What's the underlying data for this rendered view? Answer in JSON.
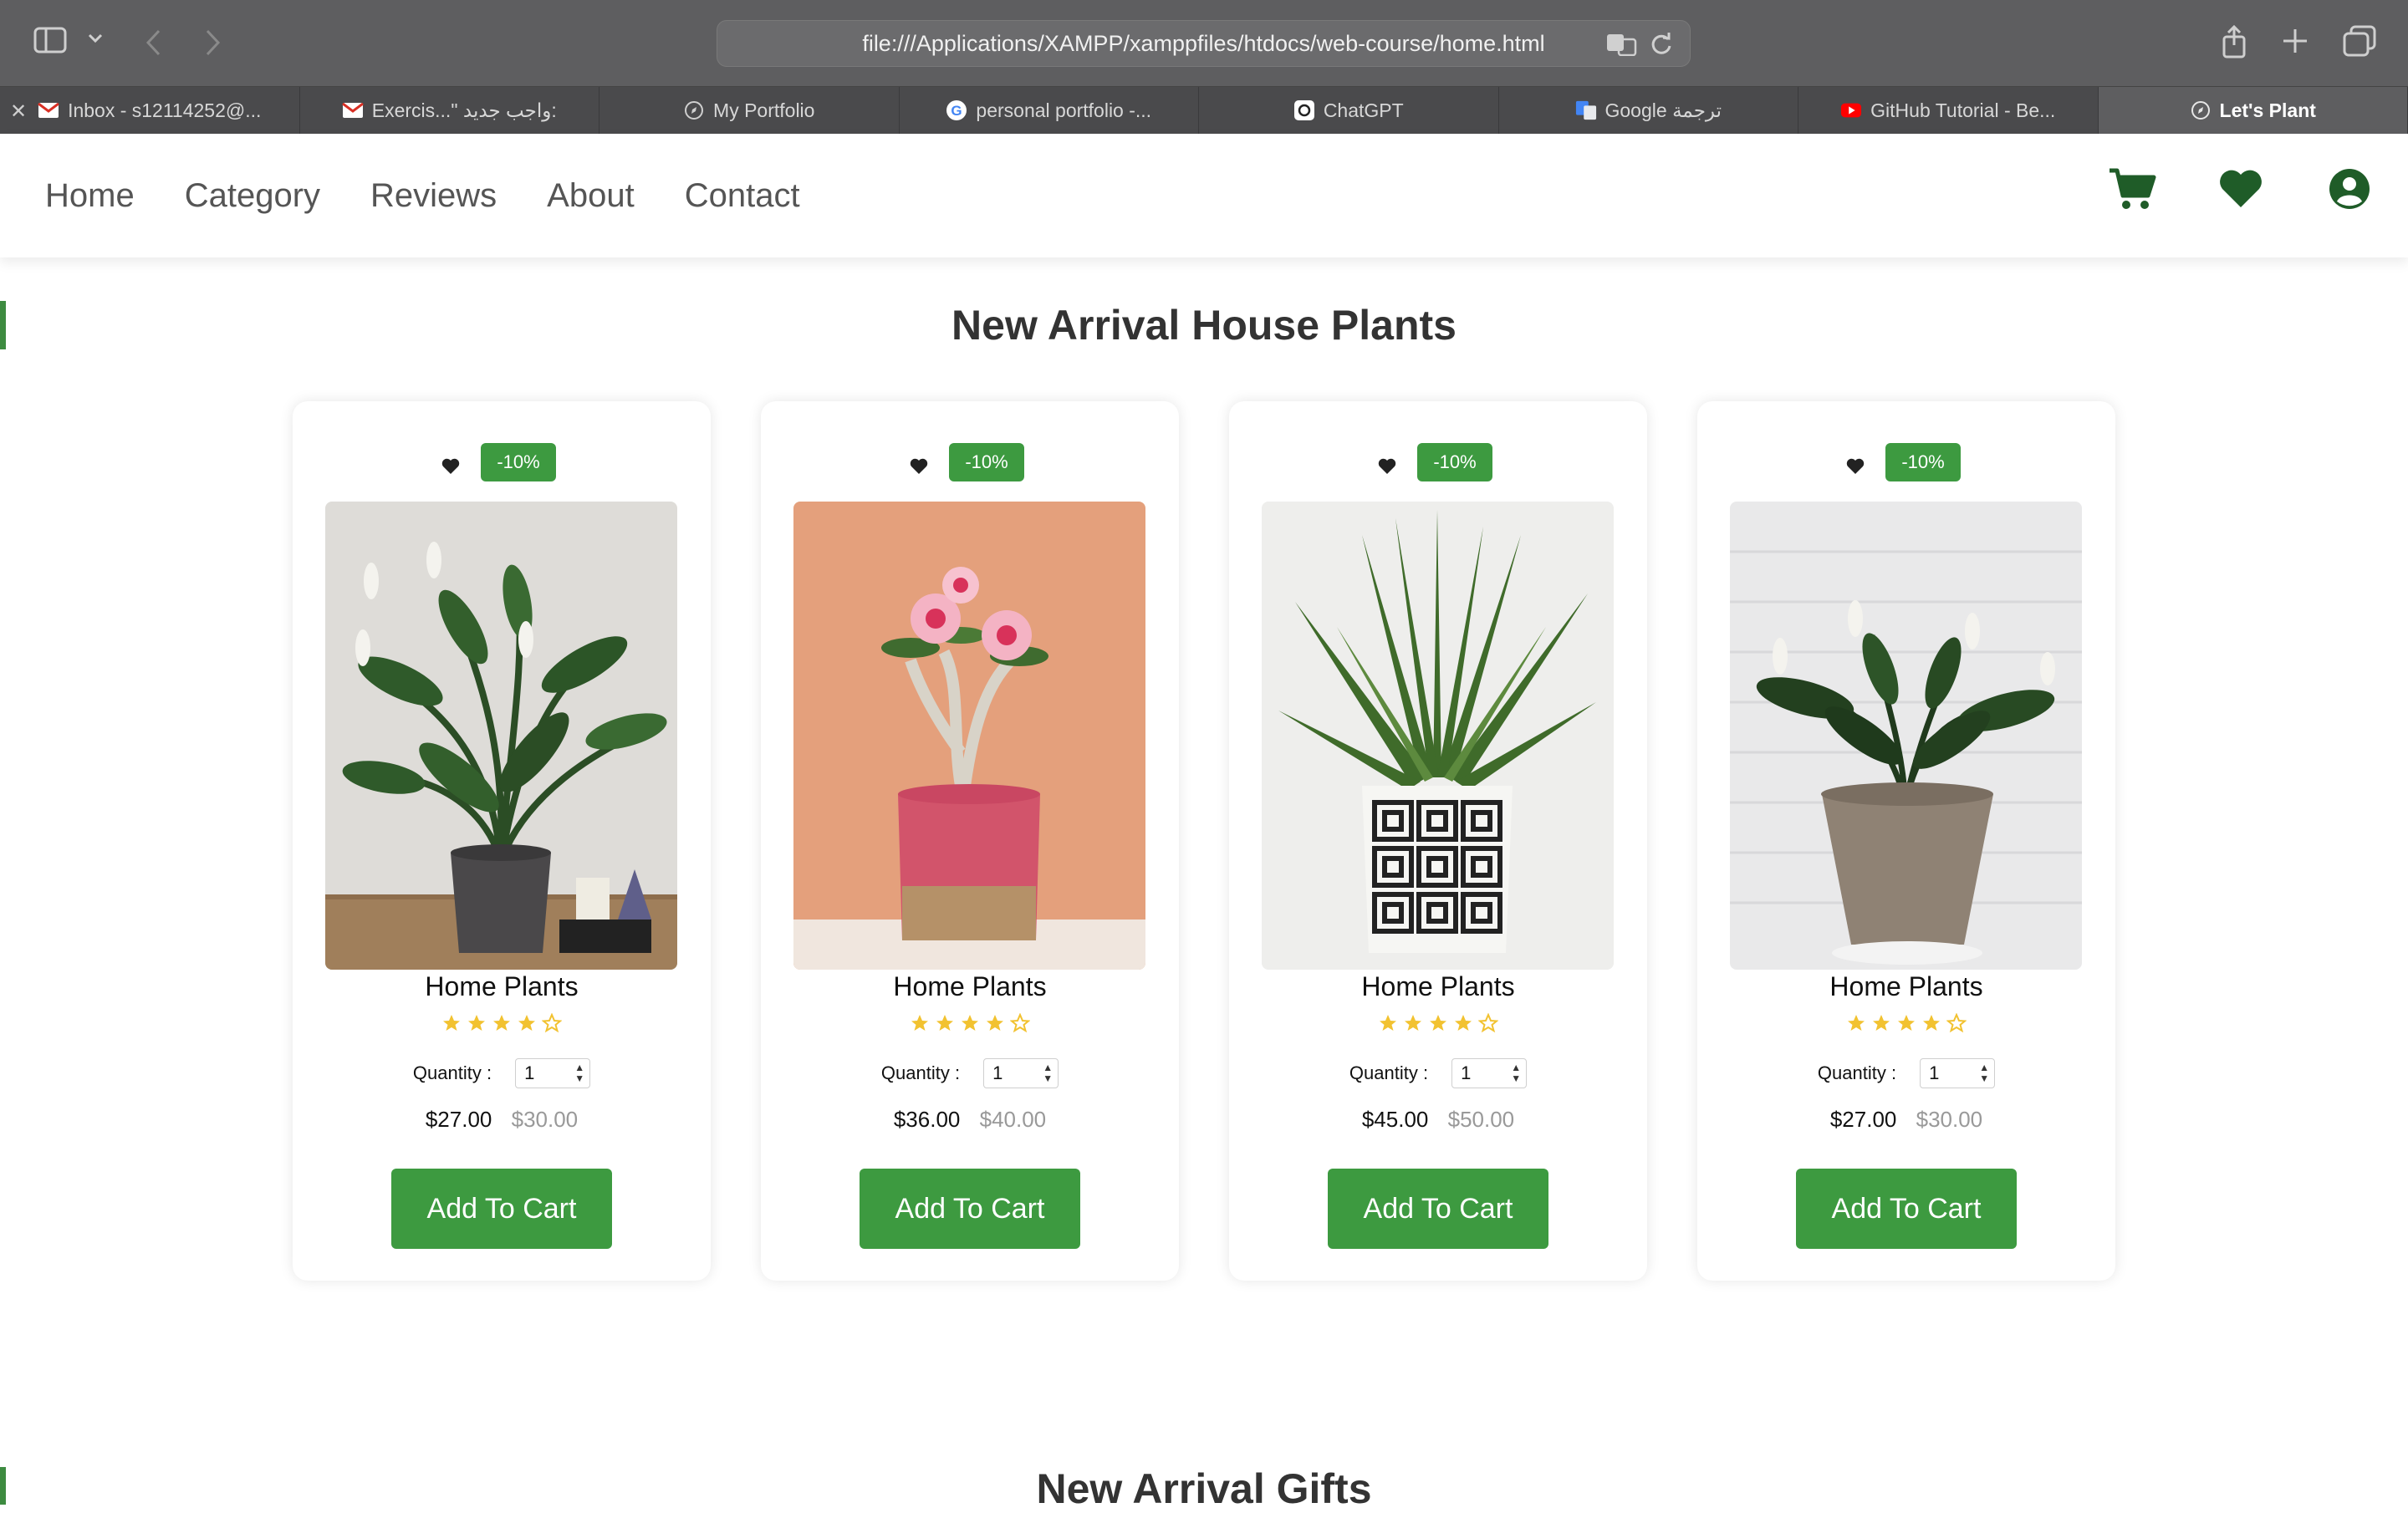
{
  "browser": {
    "url": "file:///Applications/XAMPP/xamppfiles/htdocs/web-course/home.html",
    "tabs": [
      {
        "label": "Inbox - s12114252@...",
        "icon": "gmail-icon"
      },
      {
        "label": "Exercis...\" واجب جديد:",
        "icon": "gmail-icon"
      },
      {
        "label": "My Portfolio",
        "icon": "compass-icon"
      },
      {
        "label": "personal portfolio -...",
        "icon": "google-icon"
      },
      {
        "label": "ChatGPT",
        "icon": "chatgpt-icon"
      },
      {
        "label": "Google ترجمة",
        "icon": "google-translate-icon"
      },
      {
        "label": "GitHub Tutorial - Be...",
        "icon": "youtube-icon"
      },
      {
        "label": "Let's Plant",
        "icon": "compass-icon",
        "active": true
      }
    ]
  },
  "nav": {
    "items": [
      "Home",
      "Category",
      "Reviews",
      "About",
      "Contact"
    ]
  },
  "header_icons": [
    "cart-icon",
    "heart-icon",
    "user-icon"
  ],
  "sections": {
    "plants_title": "New Arrival House Plants",
    "gifts_title": "New Arrival Gifts"
  },
  "colors": {
    "accent": "#3d9a40",
    "header_icon": "#1f5c28",
    "star": "#f2c230"
  },
  "products": [
    {
      "name": "Home Plants",
      "discount": "-10%",
      "rating": 4,
      "rating_max": 5,
      "quantity_label": "Quantity :",
      "quantity": "1",
      "price": "$27.00",
      "old_price": "$30.00",
      "button": "Add To Cart"
    },
    {
      "name": "Home Plants",
      "discount": "-10%",
      "rating": 4,
      "rating_max": 5,
      "quantity_label": "Quantity :",
      "quantity": "1",
      "price": "$36.00",
      "old_price": "$40.00",
      "button": "Add To Cart"
    },
    {
      "name": "Home Plants",
      "discount": "-10%",
      "rating": 4,
      "rating_max": 5,
      "quantity_label": "Quantity :",
      "quantity": "1",
      "price": "$45.00",
      "old_price": "$50.00",
      "button": "Add To Cart"
    },
    {
      "name": "Home Plants",
      "discount": "-10%",
      "rating": 4,
      "rating_max": 5,
      "quantity_label": "Quantity :",
      "quantity": "1",
      "price": "$27.00",
      "old_price": "$30.00",
      "button": "Add To Cart"
    }
  ]
}
